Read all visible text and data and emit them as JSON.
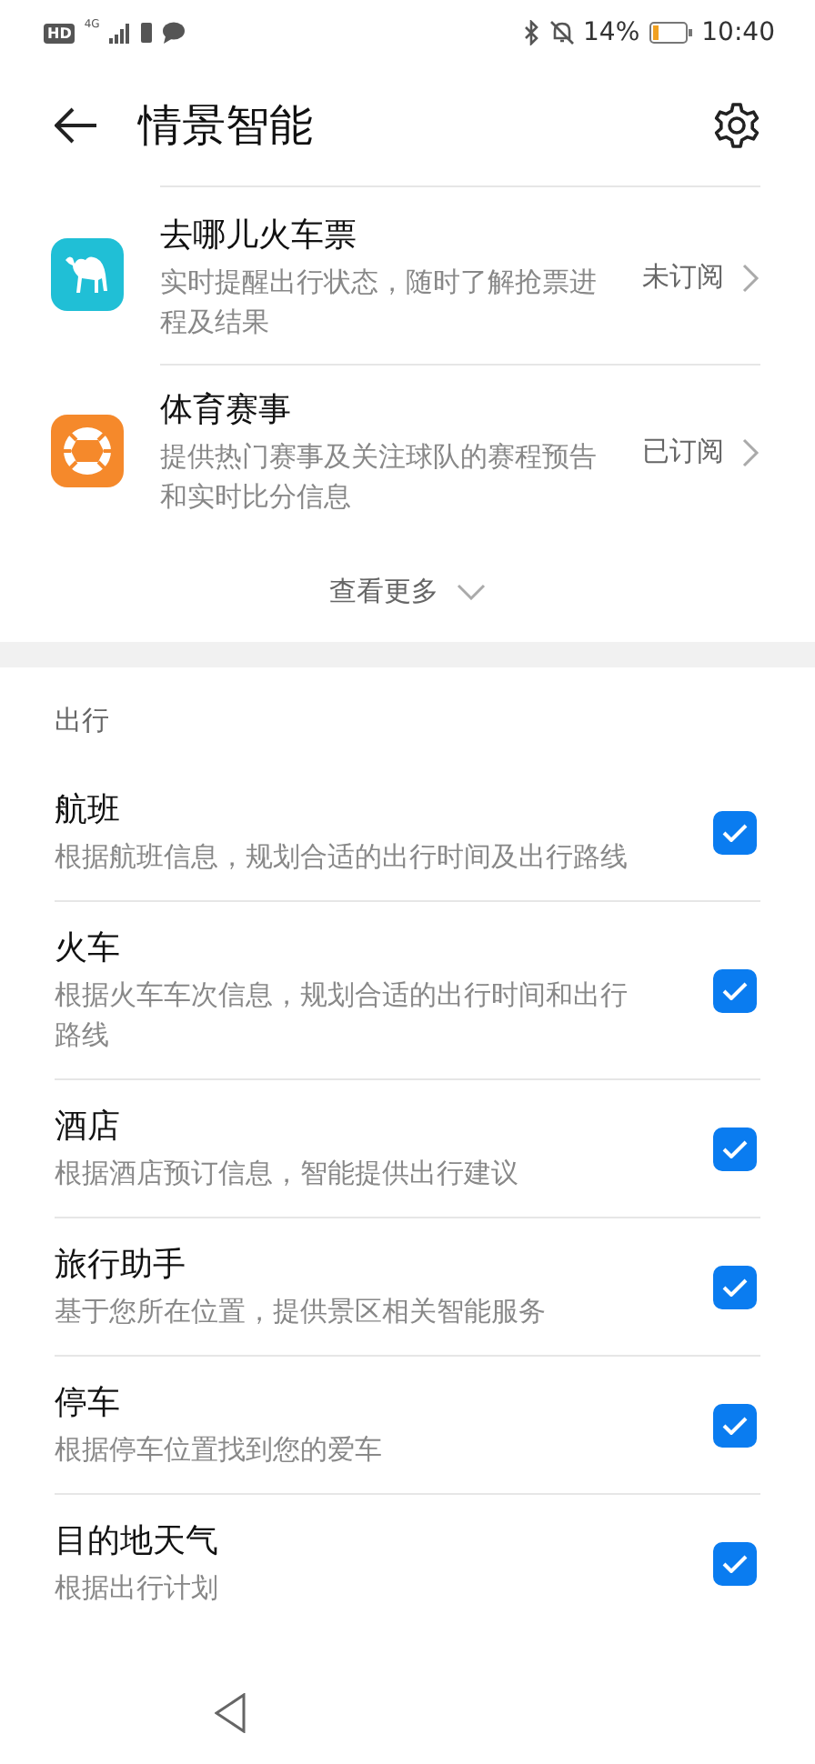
{
  "status_bar": {
    "hd": "HD",
    "network": "4G",
    "battery_percent": "14%",
    "time": "10:40"
  },
  "header": {
    "title": "情景智能"
  },
  "services": [
    {
      "kind": "camel",
      "title": "去哪儿火车票",
      "description": "实时提醒出行状态，随时了解抢票进程及结果",
      "status": "未订阅"
    },
    {
      "kind": "ball",
      "title": "体育赛事",
      "description": "提供热门赛事及关注球队的赛程预告和实时比分信息",
      "status": "已订阅"
    }
  ],
  "more": {
    "label": "查看更多"
  },
  "section": {
    "title": "出行",
    "items": [
      {
        "title": "航班",
        "description": "根据航班信息，规划合适的出行时间及出行路线",
        "checked": true
      },
      {
        "title": "火车",
        "description": "根据火车车次信息，规划合适的出行时间和出行路线",
        "checked": true
      },
      {
        "title": "酒店",
        "description": "根据酒店预订信息，智能提供出行建议",
        "checked": true
      },
      {
        "title": "旅行助手",
        "description": "基于您所在位置，提供景区相关智能服务",
        "checked": true
      },
      {
        "title": "停车",
        "description": "根据停车位置找到您的爱车",
        "checked": true
      },
      {
        "title": "目的地天气",
        "description": "根据出行计划",
        "checked": true
      }
    ]
  }
}
